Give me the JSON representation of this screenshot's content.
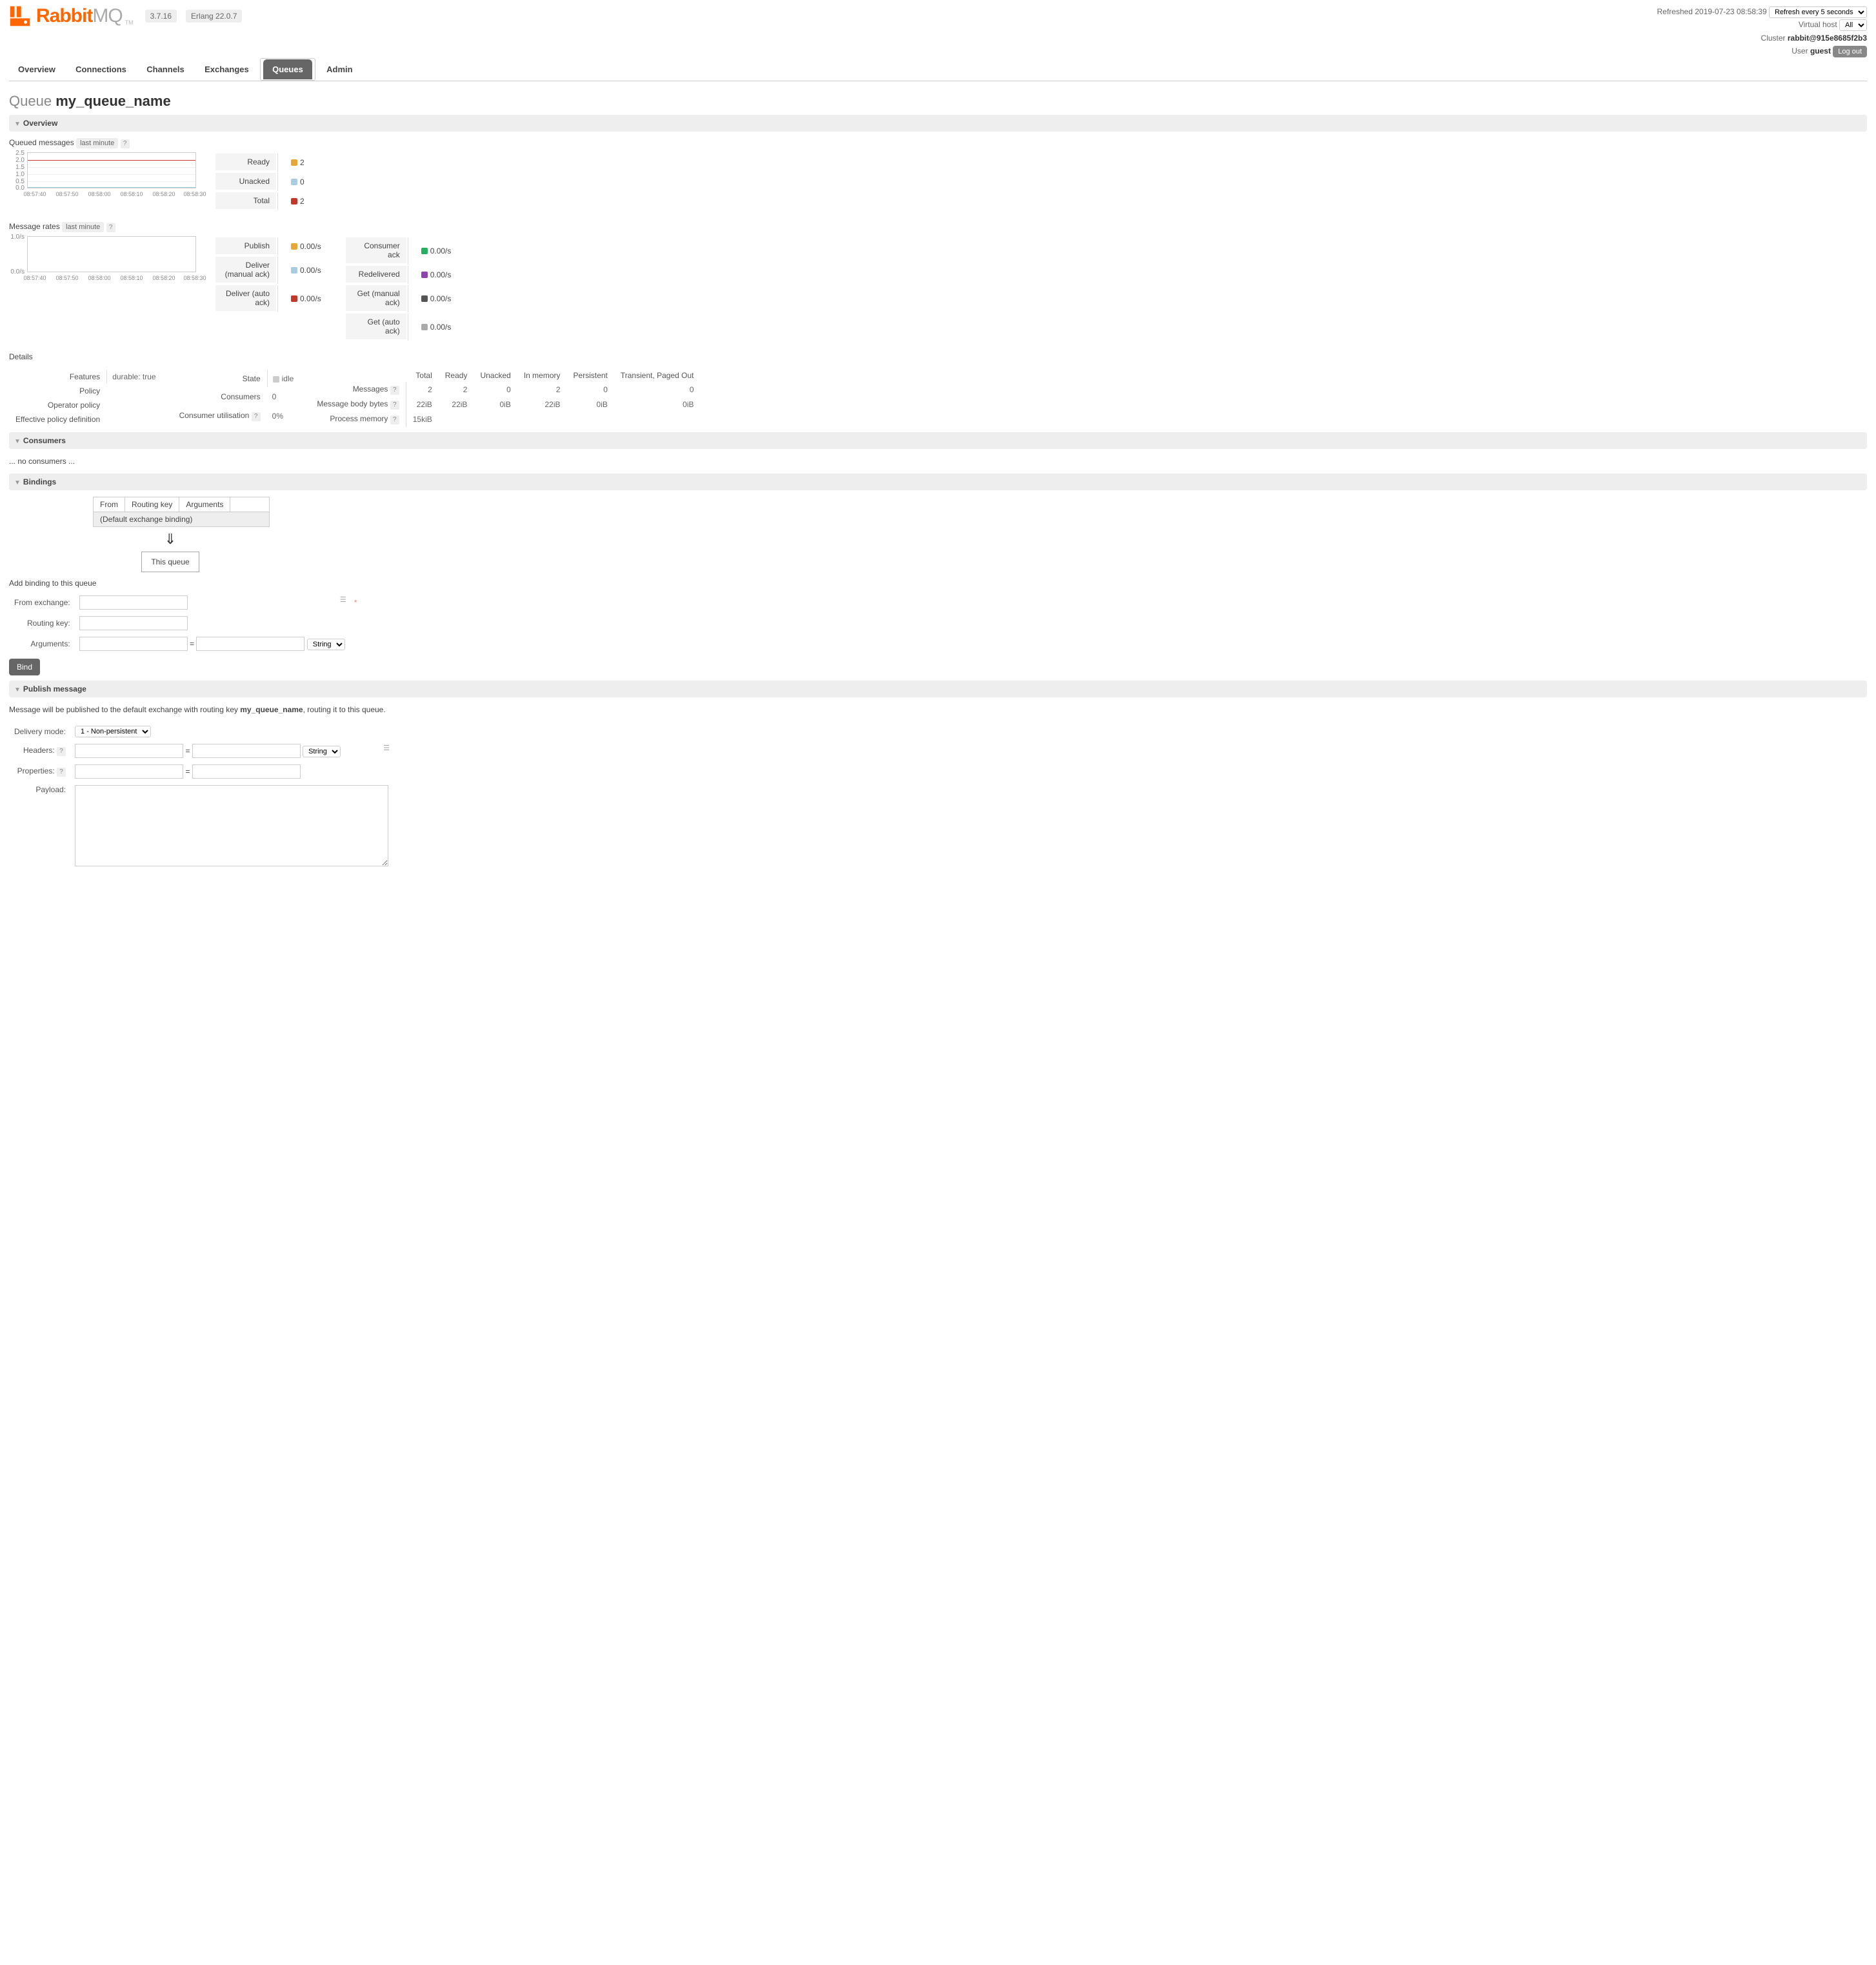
{
  "brand": {
    "name_a": "Rabbit",
    "name_b": "MQ",
    "tm": "TM"
  },
  "versions": {
    "rabbit": "3.7.16",
    "erlang": "Erlang 22.0.7"
  },
  "top": {
    "refreshed_label": "Refreshed",
    "refreshed_time": "2019-07-23 08:58:39",
    "refresh_options": [
      "Refresh every 5 seconds"
    ],
    "vhost_label": "Virtual host",
    "vhost_options": [
      "All"
    ],
    "cluster_label": "Cluster",
    "cluster": "rabbit@915e8685f2b3",
    "user_label": "User",
    "user": "guest",
    "logout": "Log out"
  },
  "tabs": [
    "Overview",
    "Connections",
    "Channels",
    "Exchanges",
    "Queues",
    "Admin"
  ],
  "active_tab": 4,
  "title": {
    "prefix": "Queue",
    "name": "my_queue_name"
  },
  "sections": {
    "overview": "Overview",
    "consumers": "Consumers",
    "bindings": "Bindings",
    "publish": "Publish message"
  },
  "queued": {
    "label": "Queued messages",
    "range": "last minute",
    "ylabels": [
      "2.5",
      "2.0",
      "1.5",
      "1.0",
      "0.5",
      "0.0"
    ],
    "xlabels": [
      "08:57:40",
      "08:57:50",
      "08:58:00",
      "08:58:10",
      "08:58:20",
      "08:58:30"
    ],
    "legend": [
      {
        "name": "Ready",
        "color": "#e8a838",
        "value": "2"
      },
      {
        "name": "Unacked",
        "color": "#a8cde0",
        "value": "0"
      },
      {
        "name": "Total",
        "color": "#c0392b",
        "value": "2"
      }
    ]
  },
  "rates": {
    "label": "Message rates",
    "range": "last minute",
    "ylabels": [
      "1.0/s",
      "0.0/s"
    ],
    "xlabels": [
      "08:57:40",
      "08:57:50",
      "08:58:00",
      "08:58:10",
      "08:58:20",
      "08:58:30"
    ],
    "left": [
      {
        "name": "Publish",
        "color": "#e8a838",
        "value": "0.00/s"
      },
      {
        "name": "Deliver (manual ack)",
        "color": "#a8cde0",
        "value": "0.00/s"
      },
      {
        "name": "Deliver (auto ack)",
        "color": "#c0392b",
        "value": "0.00/s"
      }
    ],
    "right": [
      {
        "name": "Consumer ack",
        "color": "#27ae60",
        "value": "0.00/s"
      },
      {
        "name": "Redelivered",
        "color": "#8e44ad",
        "value": "0.00/s"
      },
      {
        "name": "Get (manual ack)",
        "color": "#555",
        "value": "0.00/s"
      },
      {
        "name": "Get (auto ack)",
        "color": "#aaa",
        "value": "0.00/s"
      }
    ]
  },
  "details": {
    "heading": "Details",
    "features_label": "Features",
    "features": "durable: true",
    "policy_label": "Policy",
    "op_policy_label": "Operator policy",
    "eff_policy_label": "Effective policy definition",
    "state_label": "State",
    "state": "idle",
    "consumers_label": "Consumers",
    "consumers": "0",
    "cu_label": "Consumer utilisation",
    "cu": "0%",
    "cols": [
      "Total",
      "Ready",
      "Unacked",
      "In memory",
      "Persistent",
      "Transient, Paged Out"
    ],
    "rows": [
      {
        "label": "Messages",
        "vals": [
          "2",
          "2",
          "0",
          "2",
          "0",
          "0"
        ]
      },
      {
        "label": "Message body bytes",
        "vals": [
          "22iB",
          "22iB",
          "0iB",
          "22iB",
          "0iB",
          "0iB"
        ]
      },
      {
        "label": "Process memory",
        "vals": [
          "15kiB",
          "",
          "",
          "",
          "",
          ""
        ]
      }
    ]
  },
  "consumers": {
    "empty": "... no consumers ..."
  },
  "bindings": {
    "cols": [
      "From",
      "Routing key",
      "Arguments"
    ],
    "default_row": "(Default exchange binding)",
    "this_queue": "This queue",
    "add_label": "Add binding to this queue",
    "from_label": "From exchange:",
    "routing_label": "Routing key:",
    "args_label": "Arguments:",
    "eq": "=",
    "type_options": [
      "String"
    ],
    "bind_btn": "Bind",
    "mandatory": "*"
  },
  "publish": {
    "note_a": "Message will be published to the default exchange with routing key ",
    "note_b": ", routing it to this queue.",
    "queue": "my_queue_name",
    "delivery_label": "Delivery mode:",
    "delivery_options": [
      "1 - Non-persistent"
    ],
    "headers_label": "Headers:",
    "props_label": "Properties:",
    "payload_label": "Payload:",
    "type_options": [
      "String"
    ],
    "eq": "="
  },
  "chart_data": [
    {
      "type": "line",
      "title": "Queued messages",
      "ylim": [
        0,
        2.5
      ],
      "x": [
        "08:57:40",
        "08:57:50",
        "08:58:00",
        "08:58:10",
        "08:58:20",
        "08:58:30"
      ],
      "series": [
        {
          "name": "Ready",
          "values": [
            2,
            2,
            2,
            2,
            2,
            2
          ]
        },
        {
          "name": "Unacked",
          "values": [
            0,
            0,
            0,
            0,
            0,
            0
          ]
        },
        {
          "name": "Total",
          "values": [
            2,
            2,
            2,
            2,
            2,
            2
          ]
        }
      ]
    },
    {
      "type": "line",
      "title": "Message rates",
      "ylim": [
        0,
        1
      ],
      "x": [
        "08:57:40",
        "08:57:50",
        "08:58:00",
        "08:58:10",
        "08:58:20",
        "08:58:30"
      ],
      "series": [
        {
          "name": "Publish",
          "values": [
            0,
            0,
            0,
            0,
            0,
            0
          ]
        },
        {
          "name": "Deliver (manual ack)",
          "values": [
            0,
            0,
            0,
            0,
            0,
            0
          ]
        },
        {
          "name": "Deliver (auto ack)",
          "values": [
            0,
            0,
            0,
            0,
            0,
            0
          ]
        },
        {
          "name": "Consumer ack",
          "values": [
            0,
            0,
            0,
            0,
            0,
            0
          ]
        },
        {
          "name": "Redelivered",
          "values": [
            0,
            0,
            0,
            0,
            0,
            0
          ]
        },
        {
          "name": "Get (manual ack)",
          "values": [
            0,
            0,
            0,
            0,
            0,
            0
          ]
        },
        {
          "name": "Get (auto ack)",
          "values": [
            0,
            0,
            0,
            0,
            0,
            0
          ]
        }
      ]
    }
  ]
}
